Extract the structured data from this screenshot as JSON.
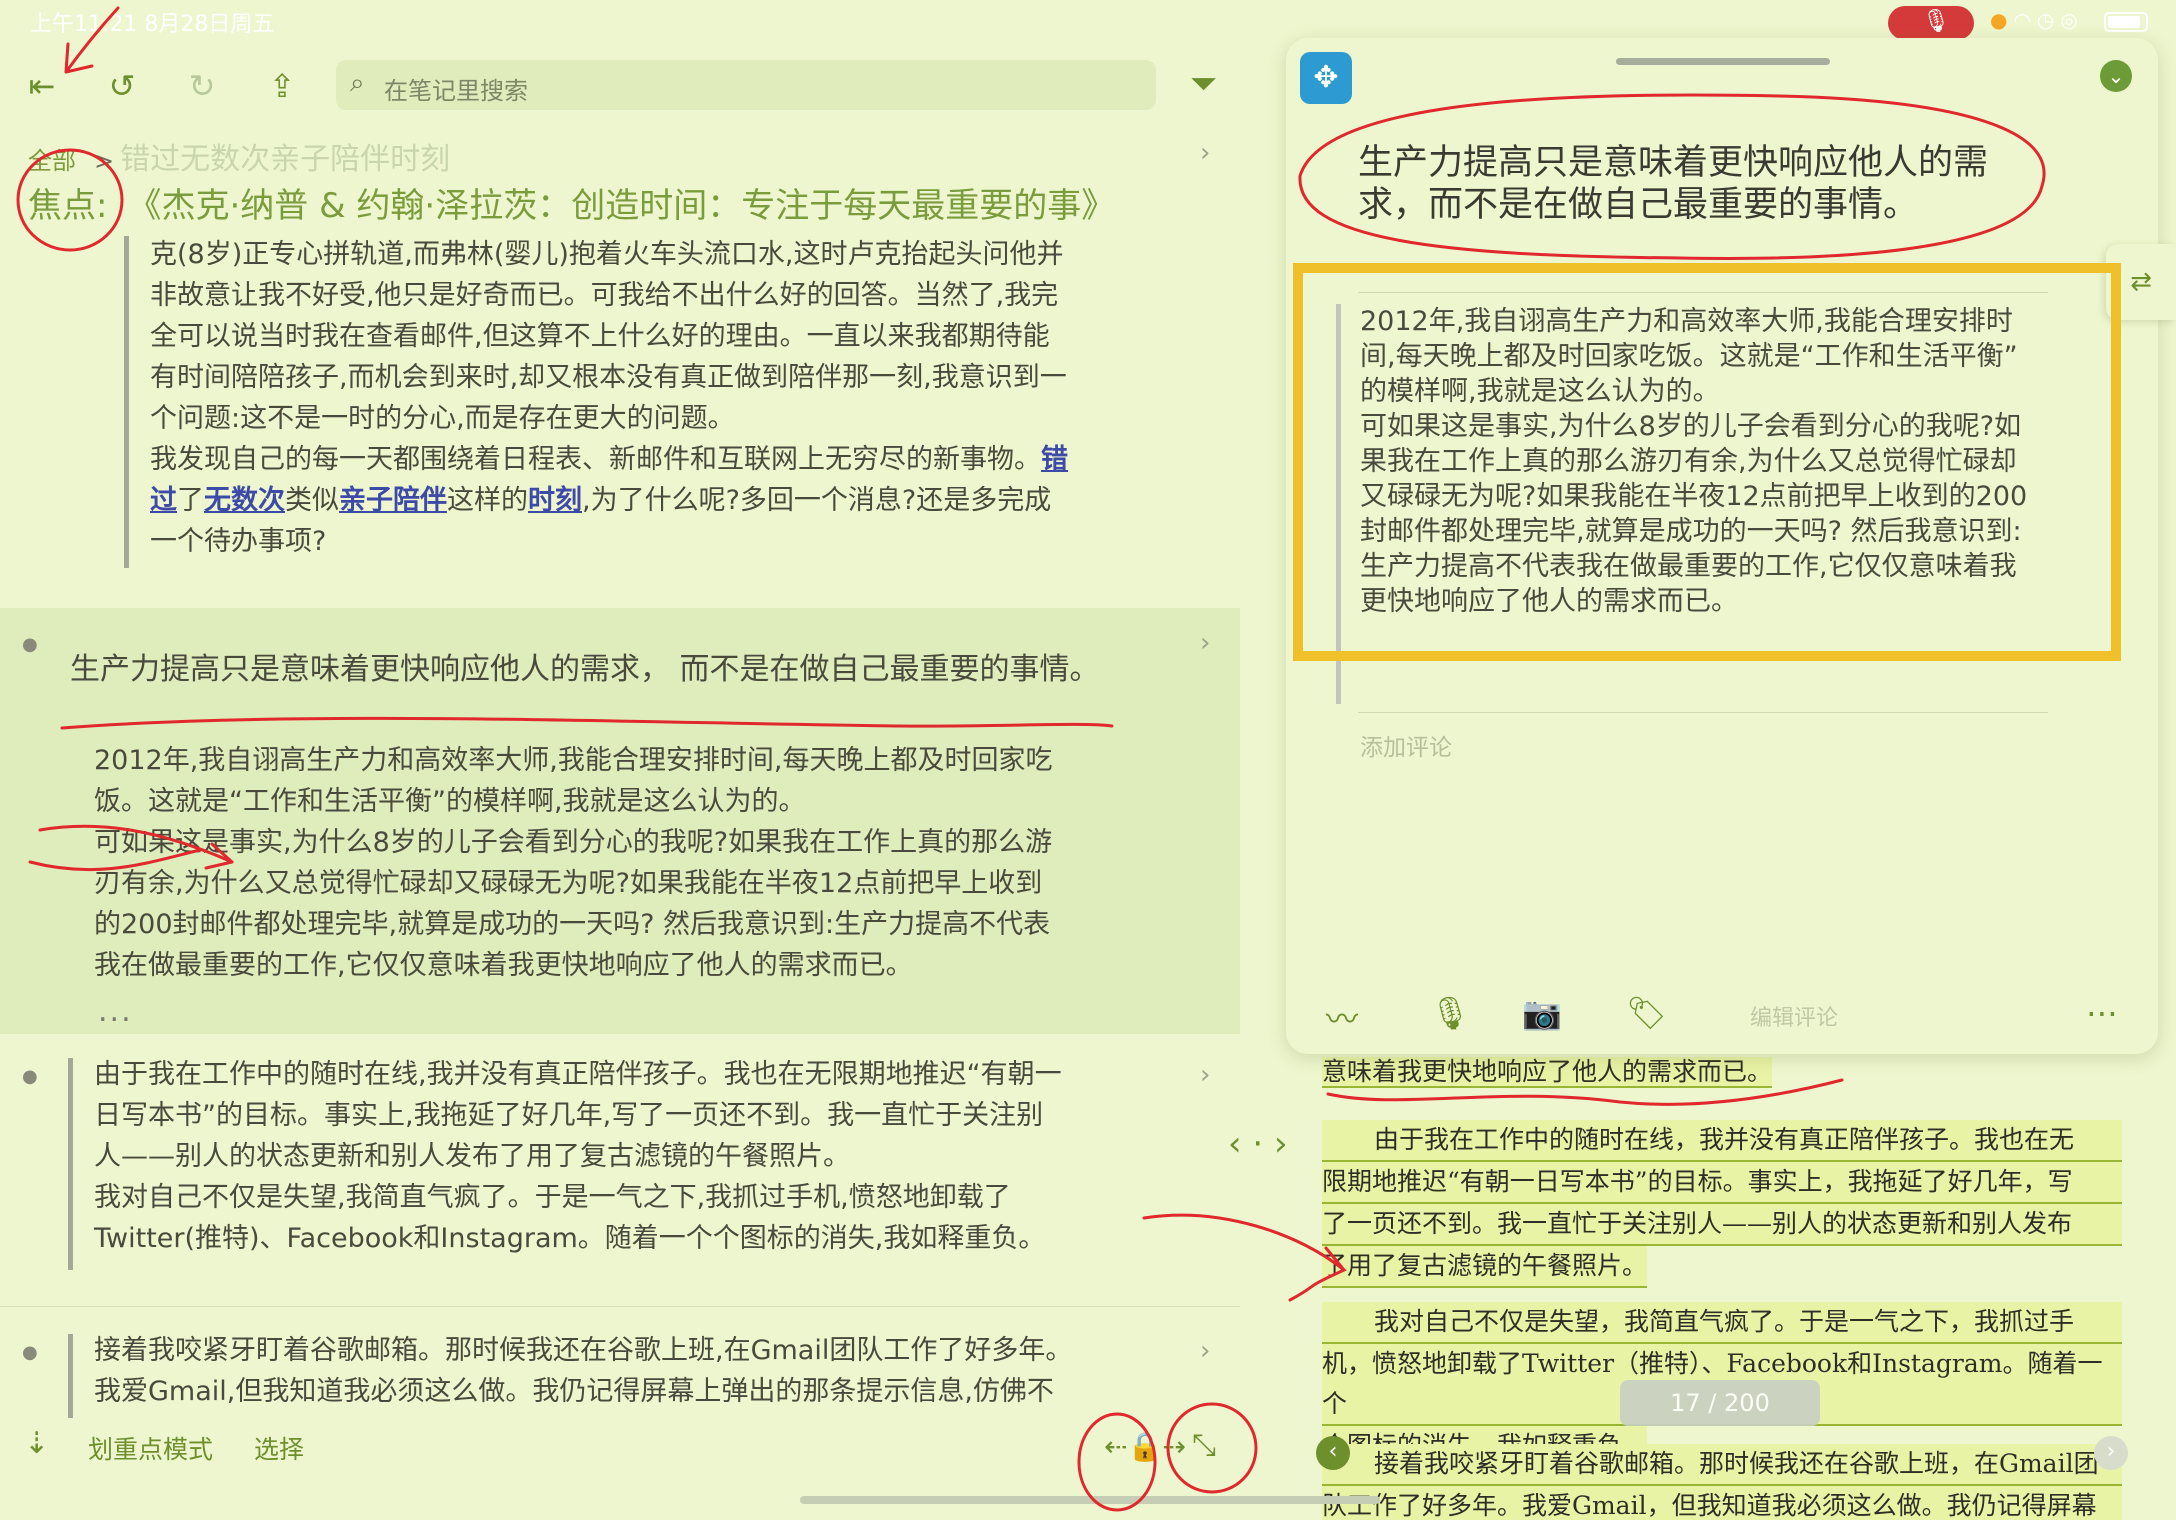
{
  "status": {
    "time": "上午11:21  8月28日周五"
  },
  "toolbar": {
    "search_placeholder": "在笔记里搜索",
    "icons": {
      "back": "sidebar-collapse-icon",
      "undo": "undo-icon",
      "redo": "redo-icon",
      "share": "share-icon",
      "filter": "filter-icon"
    }
  },
  "breadcrumb": {
    "root": "全部",
    "current": "错过无数次亲子陪伴时刻"
  },
  "focus": {
    "label": "焦点:",
    "book": "《杰克·纳普 & 约翰·泽拉茨：创造时间：专注于每天最重要的事》"
  },
  "notes": {
    "n1": {
      "lines": [
        "克(8岁)正专心拼轨道,而弗林(婴儿)抱着火车头流口水,这时卢克抬起头问他并",
        "非故意让我不好受,他只是好奇而已。可我给不出什么好的回答。当然了,我完",
        "全可以说当时我在查看邮件,但这算不上什么好的理由。一直以来我都期待能",
        "有时间陪陪孩子,而机会到来时,却又根本没有真正做到陪伴那一刻,我意识到一",
        "个问题:这不是一时的分心,而是存在更大的问题。"
      ],
      "line6_a": "我发现自己的每一天都围绕着日程表、新邮件和互联网上无穷尽的新事物。",
      "kw1": "错",
      "kw1b": "过",
      "line7_a": "了",
      "kw2": "无数次",
      "line7_b": "类似",
      "kw3": "亲子陪伴",
      "line7_c": "这样的",
      "kw4": "时刻",
      "line7_d": ",为了什么呢?多回一个消息?还是多完成",
      "line8": "一个待办事项?"
    },
    "n2": {
      "heading": "生产力提高只是意味着更快响应他人的需求， 而不是在做自己最重要的事情。",
      "lines": [
        "2012年,我自诩高生产力和高效率大师,我能合理安排时间,每天晚上都及时回家吃",
        "饭。这就是“工作和生活平衡”的模样啊,我就是这么认为的。",
        "可如果这是事实,为什么8岁的儿子会看到分心的我呢?如果我在工作上真的那么游",
        "刃有余,为什么又总觉得忙碌却又碌碌无为呢?如果我能在半夜12点前把早上收到",
        "的200封邮件都处理完毕,就算是成功的一天吗? 然后我意识到:生产力提高不代表",
        "我在做最重要的工作,它仅仅意味着我更快地响应了他人的需求而已。"
      ],
      "more": "..."
    },
    "n3": {
      "lines": [
        "由于我在工作中的随时在线,我并没有真正陪伴孩子。我也在无限期地推迟“有朝一",
        "日写本书”的目标。事实上,我拖延了好几年,写了一页还不到。我一直忙于关注别",
        "人——别人的状态更新和别人发布了用了复古滤镜的午餐照片。",
        "我对自己不仅是失望,我简直气疯了。于是一气之下,我抓过手机,愤怒地卸载了",
        "Twitter(推特)、Facebook和Instagram。随着一个个图标的消失,我如释重负。"
      ]
    },
    "n4": {
      "lines": [
        "接着我咬紧牙盯着谷歌邮箱。那时候我还在谷歌上班,在Gmail团队工作了好多年。",
        "我爱Gmail,但我知道我必须这么做。我仍记得屏幕上弹出的那条提示信息,仿佛不"
      ]
    }
  },
  "bottom": {
    "mode": "划重点模式",
    "select": "选择"
  },
  "card": {
    "title": "生产力提高只是意味着更快响应他人的需求，而不是在做自己最重要的事情。",
    "excerpt": [
      "2012年,我自诩高生产力和高效率大师,我能合理安排时",
      "间,每天晚上都及时回家吃饭。这就是“工作和生活平衡”",
      "的模样啊,我就是这么认为的。",
      "可如果这是事实,为什么8岁的儿子会看到分心的我呢?如",
      "果我在工作上真的那么游刃有余,为什么又总觉得忙碌却",
      "又碌碌无为呢?如果我能在半夜12点前把早上收到的200",
      "封邮件都处理完毕,就算是成功的一天吗? 然后我意识到:",
      "生产力提高不代表我在做最重要的工作,它仅仅意味着我",
      "更快地响应了他人的需求而已。"
    ],
    "comment_placeholder": "添加评论",
    "edit_comment": "编辑评论"
  },
  "reader": {
    "p0": "意味着我更快地响应了他人的需求而已。",
    "p1": [
      "由于我在工作中的随时在线，我并没有真正陪伴孩子。我也在无",
      "限期地推迟“有朝一日写本书”的目标。事实上，我拖延了好几年，写",
      "了一页还不到。我一直忙于关注别人——别人的状态更新和别人发布",
      "了用了复古滤镜的午餐照片。"
    ],
    "p2": [
      "我对自己不仅是失望，我简直气疯了。于是一气之下，我抓过手",
      "机，愤怒地卸载了Twitter（推特）、Facebook和Instagram。随着一个",
      "个图标的消失，我如释重负。"
    ],
    "p3": [
      "接着我咬紧牙盯着谷歌邮箱。那时候我还在谷歌上班，在Gmail团",
      "队工作了好多年。我爱Gmail，但我知道我必须这么做。我仍记得屏幕"
    ],
    "page": "17 / 200"
  },
  "colors": {
    "accent": "#6d8f2c",
    "background": "#eef6cf",
    "highlight_box": "#f0c02a",
    "annotation": "#e0282e"
  }
}
